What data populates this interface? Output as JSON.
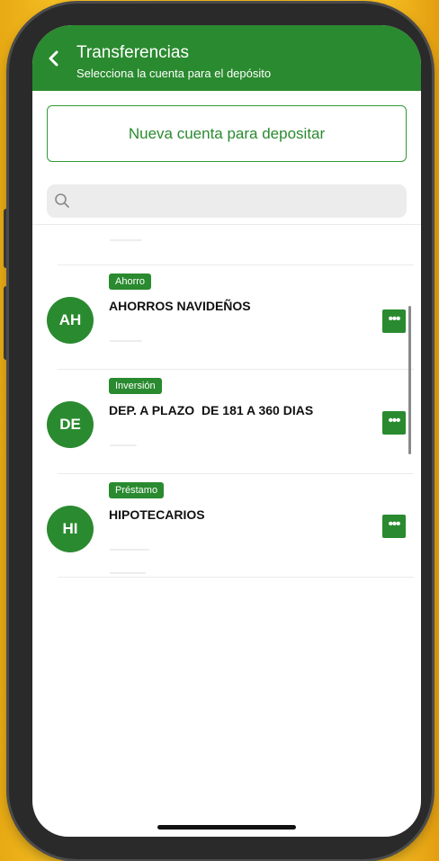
{
  "header": {
    "back_icon": "chevron-left-icon",
    "title": "Transferencias",
    "subtitle": "Selecciona la cuenta para el depósito"
  },
  "new_account_button": {
    "label": "Nueva cuenta para depositar"
  },
  "search": {
    "icon": "search-icon",
    "placeholder": "",
    "value": ""
  },
  "accounts": [
    {
      "initials": "AH",
      "type_badge": "Ahorro",
      "name": "AHORROS NAVIDEÑOS"
    },
    {
      "initials": "DE",
      "type_badge": "Inversión",
      "name": "DEP. A PLAZO  DE 181 A 360 DIAS"
    },
    {
      "initials": "HI",
      "type_badge": "Préstamo",
      "name": "HIPOTECARIOS"
    }
  ],
  "more_icon": "more-horizontal-icon",
  "colors": {
    "brand_green": "#2a8a2f",
    "background_yellow": "#f0b51c",
    "search_bg": "#ececec"
  }
}
